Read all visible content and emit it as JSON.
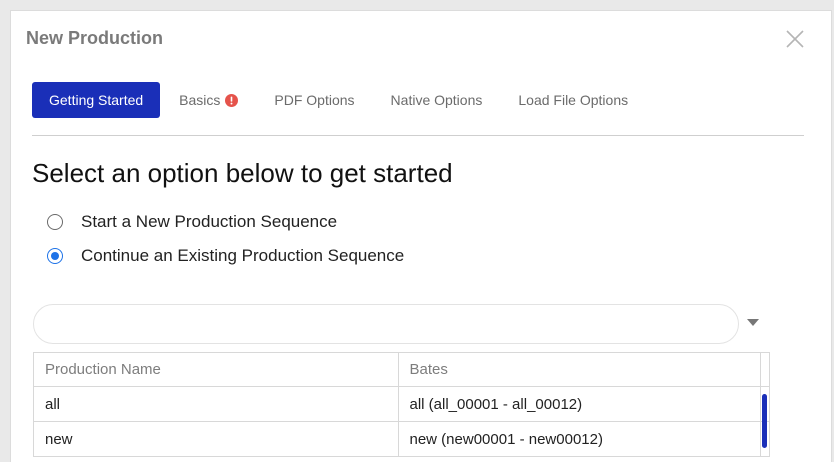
{
  "dialog": {
    "title": "New Production"
  },
  "tabs": [
    {
      "label": "Getting Started",
      "active": true
    },
    {
      "label": "Basics",
      "active": false,
      "has_warning": true
    },
    {
      "label": "PDF Options",
      "active": false
    },
    {
      "label": "Native Options",
      "active": false
    },
    {
      "label": "Load File Options",
      "active": false
    }
  ],
  "main": {
    "heading": "Select an option below to get started",
    "options": [
      {
        "label": "Start a New Production Sequence",
        "checked": false
      },
      {
        "label": "Continue an Existing Production Sequence",
        "checked": true
      }
    ],
    "select": {
      "value": ""
    }
  },
  "table": {
    "columns": [
      "Production Name",
      "Bates"
    ],
    "rows": [
      {
        "name": "all",
        "bates": "all (all_00001 - all_00012)"
      },
      {
        "name": "new",
        "bates": "new (new00001 - new00012)"
      }
    ]
  },
  "colors": {
    "accent": "#1a2fb8",
    "radio_checked": "#1e73e8",
    "warning": "#e5534b"
  },
  "icons": {
    "close": "close-icon",
    "warning": "warning-icon",
    "dropdown": "chevron-down-icon"
  }
}
